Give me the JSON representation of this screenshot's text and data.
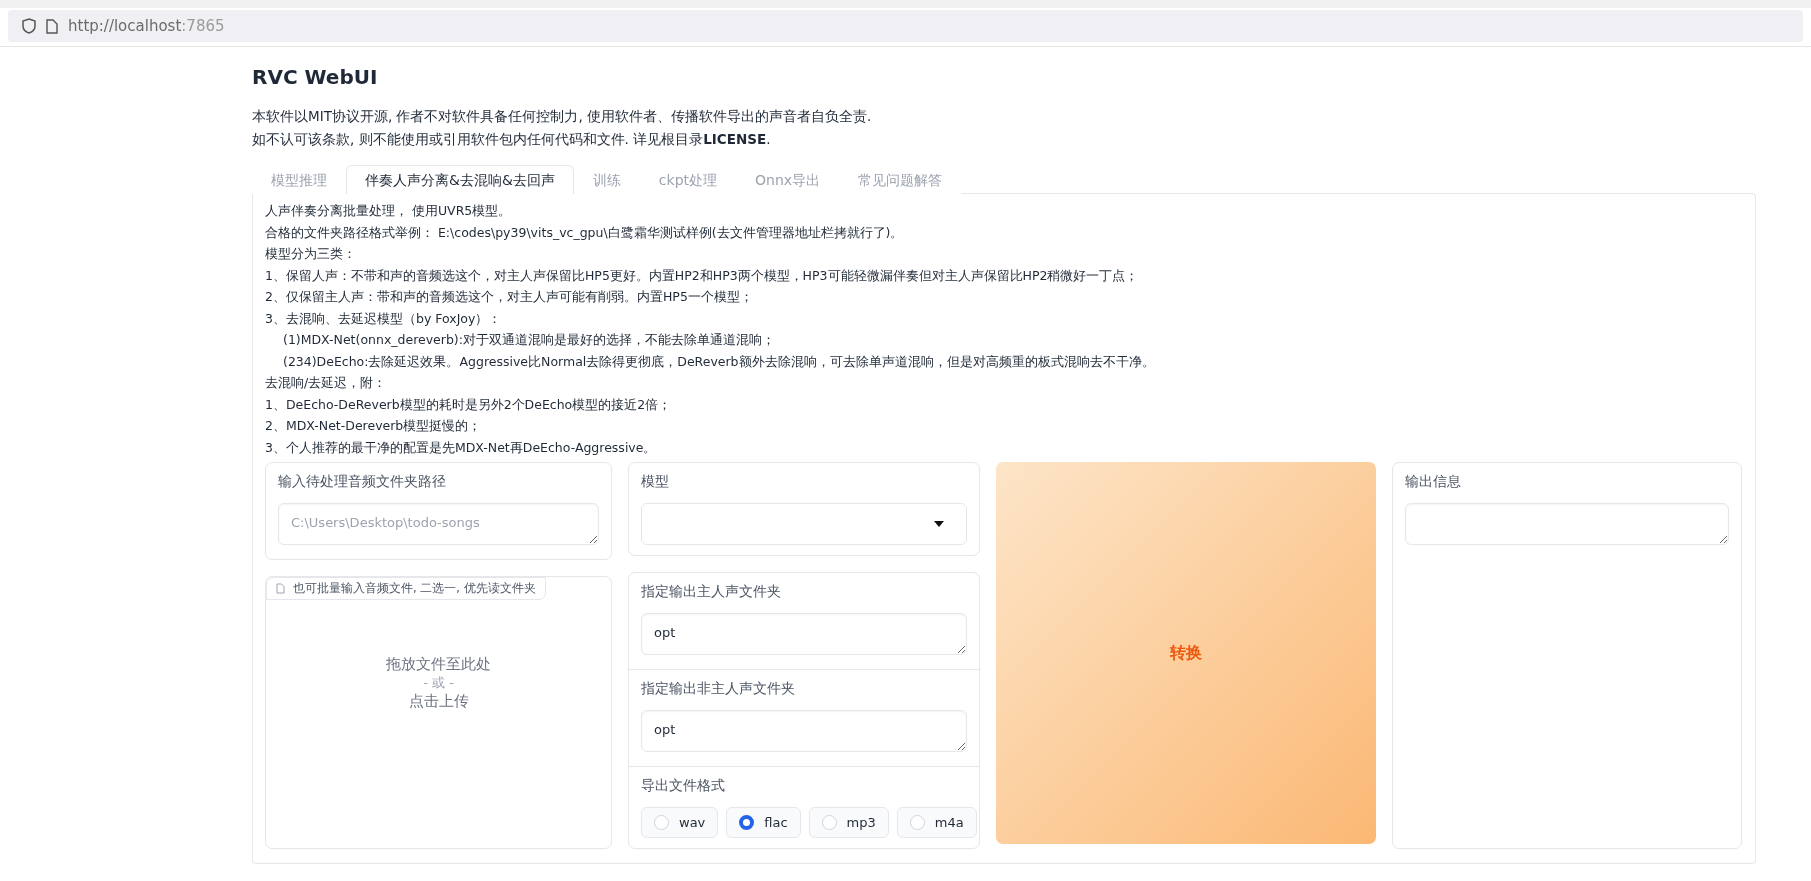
{
  "browser": {
    "url_host": "http://localhost",
    "url_port": ":7865"
  },
  "title": "RVC WebUI",
  "intro": [
    "本软件以MIT协议开源, 作者不对软件具备任何控制力, 使用软件者、传播软件导出的声音者自负全责.",
    "如不认可该条款, 则不能使用或引用软件包内任何代码和文件. 详见根目录**LICENSE**."
  ],
  "tabs": [
    {
      "label": "模型推理",
      "selected": false
    },
    {
      "label": "伴奏人声分离&去混响&去回声",
      "selected": true
    },
    {
      "label": "训练",
      "selected": false
    },
    {
      "label": "ckpt处理",
      "selected": false
    },
    {
      "label": "Onnx导出",
      "selected": false
    },
    {
      "label": "常见问题解答",
      "selected": false
    }
  ],
  "instructions": [
    {
      "text": "人声伴奏分离批量处理， 使用UVR5模型。",
      "indent": false
    },
    {
      "text": "合格的文件夹路径格式举例： E:\\codes\\py39\\vits_vc_gpu\\白鹭霜华测试样例(去文件管理器地址栏拷就行了)。",
      "indent": false
    },
    {
      "text": "模型分为三类：",
      "indent": false
    },
    {
      "text": "1、保留人声：不带和声的音频选这个，对主人声保留比HP5更好。内置HP2和HP3两个模型，HP3可能轻微漏伴奏但对主人声保留比HP2稍微好一丁点；",
      "indent": false
    },
    {
      "text": "2、仅保留主人声：带和声的音频选这个，对主人声可能有削弱。内置HP5一个模型；",
      "indent": false
    },
    {
      "text": "3、去混响、去延迟模型（by FoxJoy）：",
      "indent": false
    },
    {
      "text": "(1)MDX-Net(onnx_dereverb):对于双通道混响是最好的选择，不能去除单通道混响；",
      "indent": true
    },
    {
      "text": "(234)DeEcho:去除延迟效果。Aggressive比Normal去除得更彻底，DeReverb额外去除混响，可去除单声道混响，但是对高频重的板式混响去不干净。",
      "indent": true
    },
    {
      "text": "去混响/去延迟，附：",
      "indent": false
    },
    {
      "text": "1、DeEcho-DeReverb模型的耗时是另外2个DeEcho模型的接近2倍；",
      "indent": false
    },
    {
      "text": "2、MDX-Net-Dereverb模型挺慢的；",
      "indent": false
    },
    {
      "text": "3、个人推荐的最干净的配置是先MDX-Net再DeEcho-Aggressive。",
      "indent": false
    }
  ],
  "input_dir": {
    "label": "输入待处理音频文件夹路径",
    "placeholder": "C:\\Users\\Desktop\\todo-songs"
  },
  "upload": {
    "label": "也可批量输入音频文件, 二选一, 优先读文件夹",
    "drop_text": "拖放文件至此处",
    "or_text": "- 或 -",
    "click_text": "点击上传"
  },
  "model": {
    "label": "模型"
  },
  "vocal_dir": {
    "label": "指定输出主人声文件夹",
    "value": "opt"
  },
  "other_dir": {
    "label": "指定输出非主人声文件夹",
    "value": "opt"
  },
  "format": {
    "label": "导出文件格式",
    "options": [
      {
        "label": "wav",
        "selected": false
      },
      {
        "label": "flac",
        "selected": true
      },
      {
        "label": "mp3",
        "selected": false
      },
      {
        "label": "m4a",
        "selected": false
      }
    ]
  },
  "convert_button": "转换",
  "output": {
    "label": "输出信息"
  }
}
